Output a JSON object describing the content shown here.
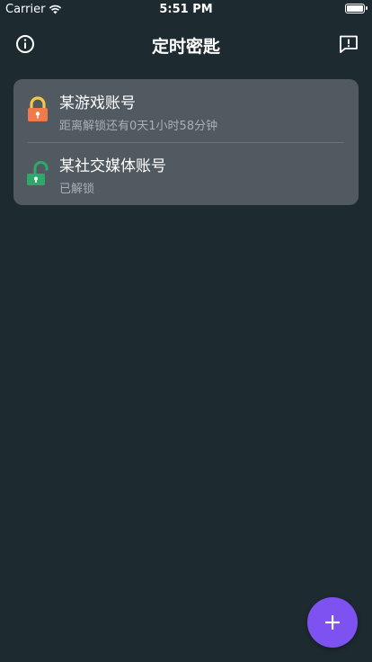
{
  "status_bar": {
    "carrier": "Carrier",
    "time": "5:51 PM"
  },
  "nav": {
    "title": "定时密匙",
    "left_icon": "info-icon",
    "right_icon": "feedback-icon"
  },
  "items": [
    {
      "title": "某游戏账号",
      "subtitle": "距离解锁还有0天1小时58分钟",
      "icon": "lock-closed-icon"
    },
    {
      "title": "某社交媒体账号",
      "subtitle": "已解锁",
      "icon": "lock-open-icon"
    }
  ],
  "fab": {
    "icon": "plus-icon"
  },
  "colors": {
    "background": "#1d2a30",
    "card": "#505a60",
    "accent": "#7d52f0",
    "lock_closed_shackle": "#f5c84a",
    "lock_closed_body": "#f07a4a",
    "lock_open": "#2fa86a"
  }
}
